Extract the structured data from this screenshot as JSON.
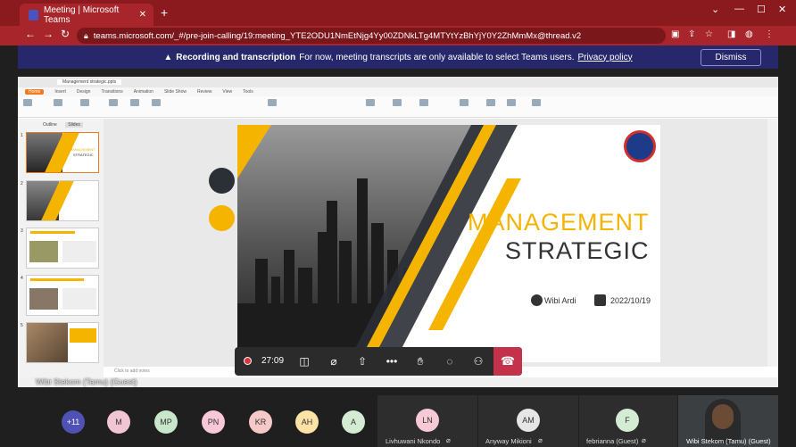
{
  "browser": {
    "tab_title": "Meeting | Microsoft Teams",
    "url": "teams.microsoft.com/_#/pre-join-calling/19:meeting_YTE2ODU1NmEtNjg4Yy00ZDNkLTg4MTYtYzBhYjY0Y2ZhMmMx@thread.v2"
  },
  "banner": {
    "heading": "Recording and transcription",
    "message": "For now, meeting transcripts are only available to select Teams users.",
    "link": "Privacy policy",
    "dismiss_label": "Dismiss"
  },
  "presentation": {
    "file_tab": "Management strategic.pptx",
    "menu_items": [
      "Home",
      "Insert",
      "Design",
      "Transitions",
      "Animation",
      "Slide Show",
      "Review",
      "View",
      "Tools"
    ],
    "active_menu": "Home",
    "thumb_tabs": [
      "Outline",
      "Slides"
    ],
    "slide_numbers": [
      "1",
      "2",
      "3",
      "4",
      "5"
    ],
    "notes_placeholder": "Click to add notes",
    "slide": {
      "title_line1": "MANAGEMENT",
      "title_line2": "STRATEGIC",
      "author": "Wibi Ardi",
      "date": "2022/10/19"
    },
    "presenter_label": "Wibi Stekom (Tamu) (Guest)"
  },
  "call": {
    "timer": "27:09"
  },
  "participants": [
    {
      "initials": "+11",
      "color": "#4f52b2"
    },
    {
      "initials": "M",
      "color": "#f1c6d4"
    },
    {
      "initials": "MP",
      "color": "#c8e6c9"
    },
    {
      "initials": "PN",
      "color": "#f8c8d8"
    },
    {
      "initials": "KR",
      "color": "#f6c9c9"
    },
    {
      "initials": "AH",
      "color": "#fde2a7"
    },
    {
      "initials": "A",
      "color": "#d5ecd4"
    }
  ],
  "named_tiles": [
    {
      "initials": "LN",
      "name": "Livhuwani Nkondo",
      "color": "#f6c9d4"
    },
    {
      "initials": "AM",
      "name": "Anyway Mikioni",
      "color": "#e6e6e6"
    },
    {
      "initials": "F",
      "name": "febrianna (Guest)",
      "color": "#d5ecd4"
    }
  ],
  "video_participant": "Wibi Stekom (Tamu) (Guest)"
}
